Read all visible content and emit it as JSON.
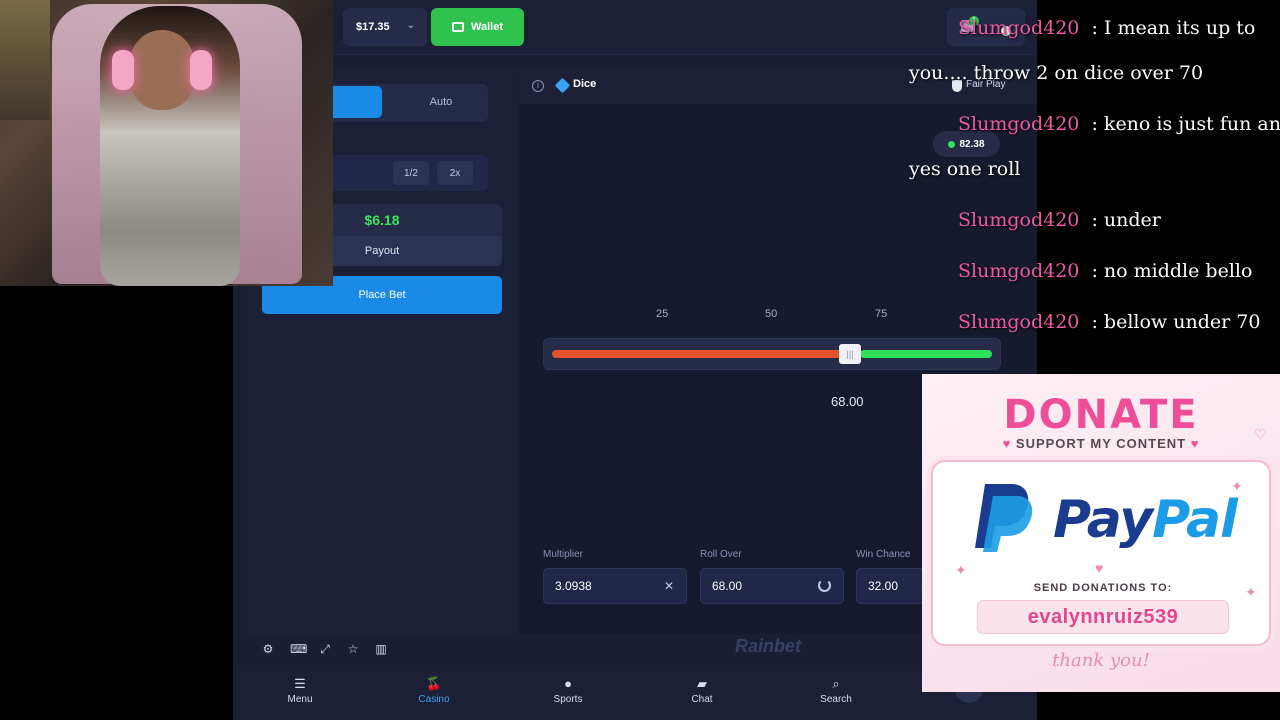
{
  "topbar": {
    "balance": "$17.35",
    "wallet_label": "Wallet",
    "notification_count": "1"
  },
  "left_panel": {
    "tab_manual": "al",
    "tab_auto": "Auto",
    "half": "1/2",
    "double": "2x",
    "payout_value": "$6.18",
    "payout_label": "Payout",
    "place_bet": "Place Bet"
  },
  "game": {
    "title": "Dice",
    "fair_play": "Fair Play",
    "last_result": "82.38",
    "ticks": [
      "25",
      "50",
      "75"
    ],
    "slider_value": 68.0,
    "slider_readout": "68.00",
    "colors": {
      "under": "#e4522a",
      "over": "#2fe05a",
      "accent": "#1a8ae8"
    },
    "fields": {
      "multiplier_label": "Multiplier",
      "multiplier_value": "3.0938",
      "roll_over_label": "Roll Over",
      "roll_over_value": "68.00",
      "win_chance_label": "Win Chance",
      "win_chance_value": "32.00"
    },
    "toolbar_icons": [
      "gear-icon",
      "keyboard-icon",
      "expand-icon",
      "star-icon",
      "stats-icon"
    ],
    "brand": "Rainbet"
  },
  "bottom_nav": [
    {
      "label": "Menu",
      "icon": "menu-icon",
      "active": false
    },
    {
      "label": "Casino",
      "icon": "cherry-icon",
      "active": true
    },
    {
      "label": "Sports",
      "icon": "ball-icon",
      "active": false
    },
    {
      "label": "Chat",
      "icon": "chat-icon",
      "active": false
    },
    {
      "label": "Search",
      "icon": "search-icon",
      "active": false
    }
  ],
  "chat": {
    "lines": [
      {
        "user": "Slumgod420",
        "text": ": I mean its up to"
      },
      {
        "user": "",
        "text": "you.... throw 2 on dice over 70"
      },
      {
        "user": "Slumgod420",
        "text": ": keno is just fun and"
      },
      {
        "user": "",
        "text": "yes one roll"
      },
      {
        "user": "Slumgod420",
        "text": ": under"
      },
      {
        "user": "Slumgod420",
        "text": ": no middle bello"
      },
      {
        "user": "Slumgod420",
        "text": ": bellow under 70"
      }
    ]
  },
  "donate": {
    "title": "DONATE",
    "subtitle": "SUPPORT MY CONTENT",
    "paypal_pay": "Pay",
    "paypal_pal": "Pal",
    "send_to": "SEND DONATIONS TO:",
    "handle": "evalynnruiz539",
    "thanks": "thank you!"
  }
}
